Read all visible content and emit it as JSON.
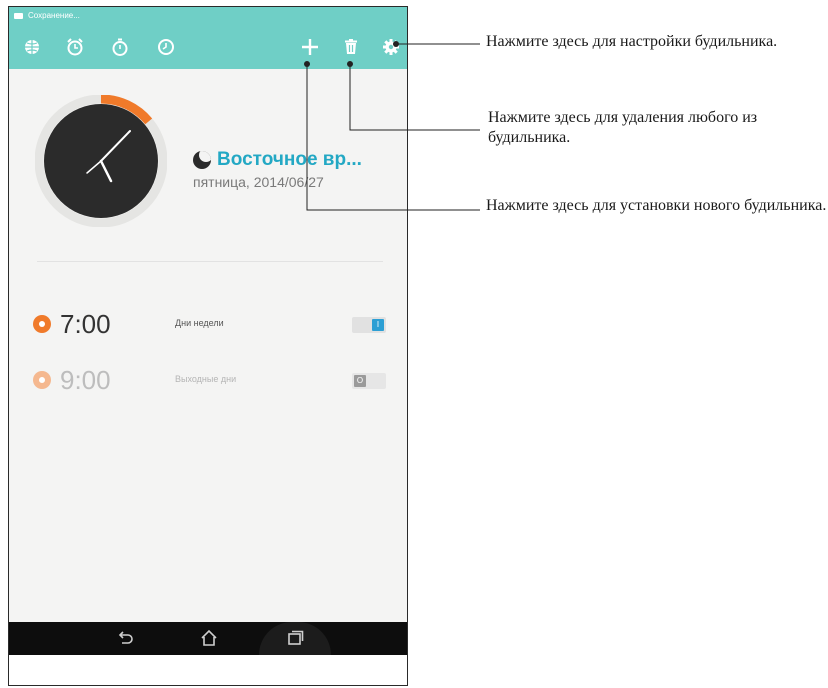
{
  "status_bar": {
    "text": "Сохранение..."
  },
  "toolbar": {
    "icons": [
      "globe-icon",
      "alarm-icon",
      "stopwatch-icon",
      "timer-icon",
      "add-icon",
      "trash-icon",
      "settings-icon"
    ],
    "color": "#6fcfc6"
  },
  "world_clock": {
    "timezone_name": "Восточное вр...",
    "date": "пятница, 2014/06/27"
  },
  "alarms": [
    {
      "time": "7:00",
      "label": "Дни недели",
      "toggle": "I",
      "enabled": true,
      "color": "#f07a2a"
    },
    {
      "time": "9:00",
      "label": "Выходные дни",
      "toggle": "O",
      "enabled": false,
      "color": "#f5b88f"
    }
  ],
  "annotations": {
    "settings": "Нажмите здесь для настройки будильника.",
    "delete": "Нажмите здесь для удаления любого из будильника.",
    "add": "Нажмите здесь для установки нового будильника."
  },
  "colors": {
    "accent": "#23a8c4",
    "header": "#6fcfc6",
    "alarm_orange": "#f07a2a",
    "toggle_on": "#2c9fd4"
  }
}
